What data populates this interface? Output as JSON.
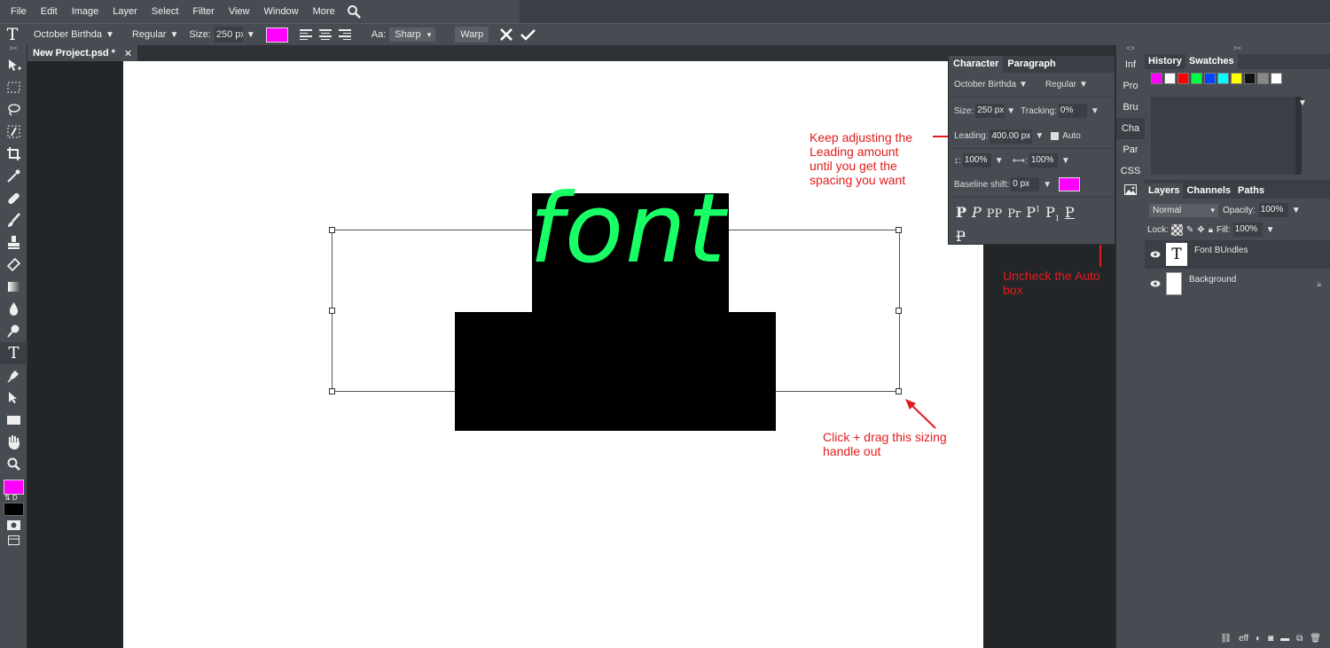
{
  "menu": {
    "items": [
      "File",
      "Edit",
      "Image",
      "Layer",
      "Select",
      "Filter",
      "View",
      "Window",
      "More"
    ]
  },
  "options": {
    "font_family": "October Birthda",
    "font_style": "Regular",
    "size_label": "Size:",
    "size_value": "250 px",
    "aa_label": "Aa:",
    "aa_value": "Sharp",
    "warp_label": "Warp",
    "color": "#ff00ff"
  },
  "document": {
    "tab_title": "New Project.psd *",
    "text": "font",
    "text_color": "#19ff66"
  },
  "character_panel": {
    "tabs": [
      "Character",
      "Paragraph"
    ],
    "font_family": "October Birthda",
    "font_style": "Regular",
    "size_label": "Size:",
    "size_value": "250 px",
    "tracking_label": "Tracking:",
    "tracking_value": "0%",
    "leading_label": "Leading:",
    "leading_value": "400.00 px",
    "auto_label": "Auto",
    "vscale_value": "100%",
    "hscale_value": "100%",
    "baseline_label": "Baseline shift:",
    "baseline_value": "0 px",
    "color": "#ff00ff"
  },
  "narrow_panel": {
    "items": [
      "Inf",
      "Pro",
      "Bru",
      "Cha",
      "Par",
      "CSS"
    ]
  },
  "history_panel": {
    "tabs": [
      "History",
      "Swatches"
    ],
    "swatches": [
      "#ff00ff",
      "#ffffff",
      "#ff0000",
      "#00ff44",
      "#0044ff",
      "#00ffff",
      "#ffff00",
      "#111111",
      "#888888",
      "#ffffff"
    ]
  },
  "layers_panel": {
    "tabs": [
      "Layers",
      "Channels",
      "Paths"
    ],
    "blend_mode": "Normal",
    "opacity_label": "Opacity:",
    "opacity_value": "100%",
    "lock_label": "Lock:",
    "fill_label": "Fill:",
    "fill_value": "100%",
    "layers": [
      {
        "name": "Font BUndles",
        "type": "text"
      },
      {
        "name": "Background",
        "type": "image"
      }
    ],
    "footer_off": "eff"
  },
  "annotations": {
    "leading_note": [
      "Keep adjusting the",
      "Leading amount",
      "until you get the",
      "spacing you want"
    ],
    "auto_note": [
      "Uncheck the Auto",
      "box"
    ],
    "handle_note": [
      "Click + drag this sizing",
      "handle out"
    ],
    "color": "#e21b1b"
  }
}
